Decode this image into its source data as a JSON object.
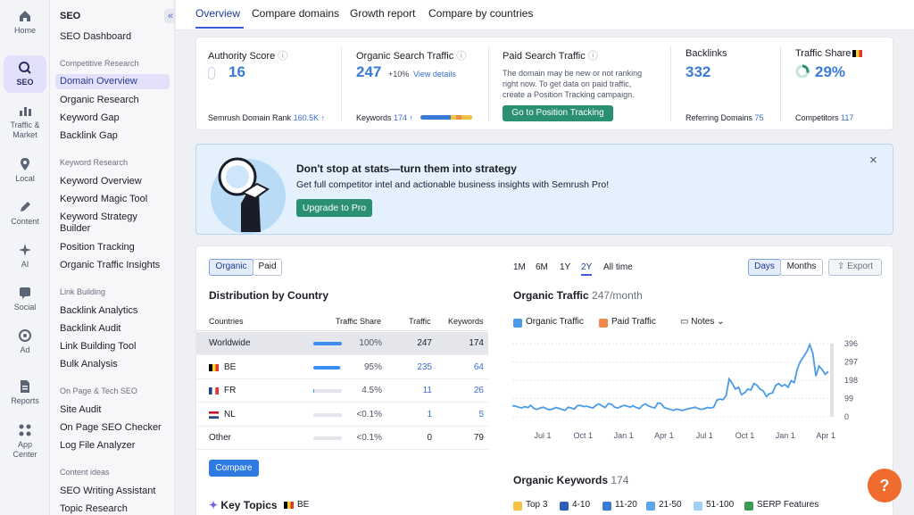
{
  "rail": {
    "items": [
      {
        "label": "Home"
      },
      {
        "label": "SEO"
      },
      {
        "label": "Traffic &",
        "label2": "Market"
      },
      {
        "label": "Local"
      },
      {
        "label": "Content"
      },
      {
        "label": "AI"
      },
      {
        "label": "Social"
      },
      {
        "label": "Ad"
      },
      {
        "label": "Reports"
      },
      {
        "label": "App",
        "label2": "Center"
      }
    ]
  },
  "nav": {
    "title": "SEO",
    "collapse": "«",
    "dashboard": "SEO Dashboard",
    "sections": [
      {
        "title": "Competitive Research",
        "items": [
          "Domain Overview",
          "Organic Research",
          "Keyword Gap",
          "Backlink Gap"
        ]
      },
      {
        "title": "Keyword Research",
        "items": [
          "Keyword Overview",
          "Keyword Magic Tool",
          "Keyword Strategy",
          "Builder",
          "Position Tracking",
          "Organic Traffic Insights"
        ]
      },
      {
        "title": "Link Building",
        "items": [
          "Backlink Analytics",
          "Backlink Audit",
          "Link Building Tool",
          "Bulk Analysis"
        ]
      },
      {
        "title": "On Page & Tech SEO",
        "items": [
          "Site Audit",
          "On Page SEO Checker",
          "Log File Analyzer"
        ]
      },
      {
        "title": "Content ideas",
        "items": [
          "SEO Writing Assistant",
          "Topic Research"
        ]
      }
    ]
  },
  "tabs": [
    "Overview",
    "Compare domains",
    "Growth report",
    "Compare by countries"
  ],
  "metrics": {
    "authority": {
      "label": "Authority Score",
      "value": "16",
      "rank_label": "Semrush Domain Rank",
      "rank_value": "160.5K ↑"
    },
    "organic": {
      "label": "Organic Search Traffic",
      "value": "247",
      "change": "+10%",
      "details": "View details",
      "kw_label": "Keywords",
      "kw_value": "174 ↑"
    },
    "paid": {
      "label": "Paid Search Traffic",
      "line1": "The domain may be new or not ranking",
      "line2": "right now. To get data on paid traffic,",
      "line3": "create a Position Tracking campaign.",
      "button": "Go to Position Tracking"
    },
    "backlinks": {
      "label": "Backlinks",
      "value": "332",
      "ref_label": "Referring Domains",
      "ref_value": "75"
    },
    "share": {
      "label": "Traffic Share",
      "value": "29%",
      "comp_label": "Competitors",
      "comp_value": "117",
      "ring_fraction": 0.29
    }
  },
  "banner": {
    "title": "Don't stop at stats—turn them into strategy",
    "text": "Get full competitor intel and actionable business insights with Semrush Pro!",
    "button": "Upgrade to Pro",
    "close": "×"
  },
  "distribution": {
    "toggle": [
      "Organic",
      "Paid"
    ],
    "title": "Distribution by Country",
    "headers": [
      "Countries",
      "Traffic Share",
      "Traffic",
      "Keywords"
    ],
    "rows": [
      {
        "country": "Worldwide",
        "share": "100%",
        "fill": 1.0,
        "traffic": "247",
        "keywords": "174",
        "flag": ""
      },
      {
        "country": "BE",
        "share": "95%",
        "fill": 0.95,
        "traffic": "235",
        "keywords": "64",
        "flag": "be"
      },
      {
        "country": "FR",
        "share": "4.5%",
        "fill": 0.045,
        "traffic": "11",
        "keywords": "26",
        "flag": "fr"
      },
      {
        "country": "NL",
        "share": "<0.1%",
        "fill": 0.0,
        "traffic": "1",
        "keywords": "5",
        "flag": "nl"
      },
      {
        "country": "Other",
        "share": "<0.1%",
        "fill": 0.0,
        "traffic": "0",
        "keywords": "79",
        "flag": ""
      }
    ],
    "compare": "Compare"
  },
  "topics": {
    "title": "Key Topics",
    "country": "BE"
  },
  "periods": [
    "1M",
    "6M",
    "1Y",
    "2Y",
    "All time"
  ],
  "granularity": [
    "Days",
    "Months"
  ],
  "export": "Export",
  "traffic_chart": {
    "title": "Organic Traffic",
    "value": "247/month",
    "legend": [
      "Organic Traffic",
      "Paid Traffic"
    ],
    "notes": "Notes",
    "colors": {
      "organic": "#4a9be8",
      "paid": "#f08a4b"
    }
  },
  "chart_data": {
    "type": "line",
    "title": "Organic Traffic",
    "x_tick_labels": [
      "Jul 1",
      "Oct 1",
      "Jan 1",
      "Apr 1",
      "Jul 1",
      "Oct 1",
      "Jan 1",
      "Apr 1"
    ],
    "y_ticks": [
      0,
      99,
      198,
      297,
      396
    ],
    "ylim": [
      0,
      396
    ],
    "grid": true,
    "series": [
      {
        "name": "Organic Traffic",
        "values": [
          60,
          58,
          52,
          48,
          55,
          50,
          62,
          45,
          40,
          48,
          52,
          44,
          38,
          42,
          50,
          46,
          40,
          35,
          52,
          48,
          42,
          60,
          62,
          55,
          58,
          52,
          48,
          62,
          70,
          58,
          50,
          72,
          68,
          52,
          48,
          55,
          62,
          58,
          52,
          60,
          50,
          45,
          62,
          70,
          58,
          52,
          48,
          75,
          72,
          50,
          45,
          40,
          35,
          42,
          38,
          35,
          40,
          45,
          48,
          52,
          45,
          40,
          44,
          50,
          48,
          52,
          90,
          96,
          92,
          115,
          205,
          180,
          150,
          160,
          120,
          130,
          150,
          145,
          180,
          170,
          150,
          140,
          110,
          125,
          130,
          170,
          180,
          165,
          175,
          160,
          195,
          185,
          260,
          300,
          325,
          350,
          390,
          345,
          220,
          275,
          255,
          230,
          245
        ]
      }
    ]
  },
  "keywords": {
    "title": "Organic Keywords",
    "value": "174",
    "legend": [
      {
        "label": "Top 3",
        "color": "#f5c242"
      },
      {
        "label": "4-10",
        "color": "#2c5db8"
      },
      {
        "label": "11-20",
        "color": "#3b7ad8"
      },
      {
        "label": "21-50",
        "color": "#5aa6ea"
      },
      {
        "label": "51-100",
        "color": "#9fd0f5"
      },
      {
        "label": "SERP Features",
        "color": "#3a9b52"
      }
    ]
  },
  "help": "?"
}
